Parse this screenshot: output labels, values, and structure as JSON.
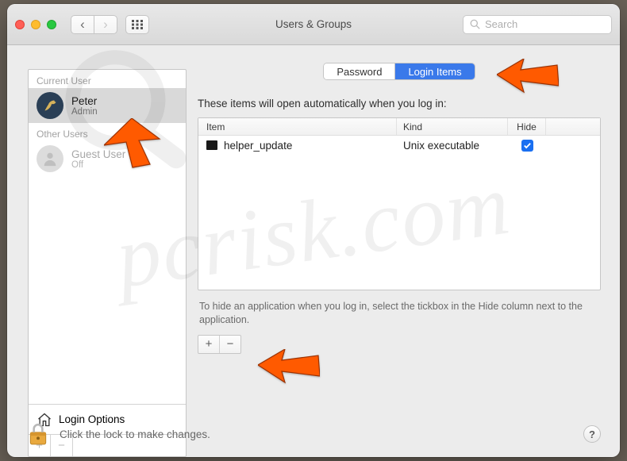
{
  "window": {
    "title": "Users & Groups"
  },
  "search": {
    "placeholder": "Search"
  },
  "sidebar": {
    "current_label": "Current User",
    "other_label": "Other Users",
    "users": [
      {
        "name": "Peter",
        "role": "Admin"
      },
      {
        "name": "Guest User",
        "role": "Off"
      }
    ],
    "login_options": "Login Options"
  },
  "tabs": {
    "password": "Password",
    "login_items": "Login Items"
  },
  "main": {
    "heading": "These items will open automatically when you log in:",
    "columns": {
      "item": "Item",
      "kind": "Kind",
      "hide": "Hide"
    },
    "rows": [
      {
        "item": "helper_update",
        "kind": "Unix executable",
        "hide": true
      }
    ],
    "hint": "To hide an application when you log in, select the tickbox in the Hide column next to the application."
  },
  "footer": {
    "lock_text": "Click the lock to make changes.",
    "help": "?"
  },
  "glyph": {
    "plus": "+",
    "minus": "−",
    "chev_left": "‹",
    "chev_right": "›"
  }
}
